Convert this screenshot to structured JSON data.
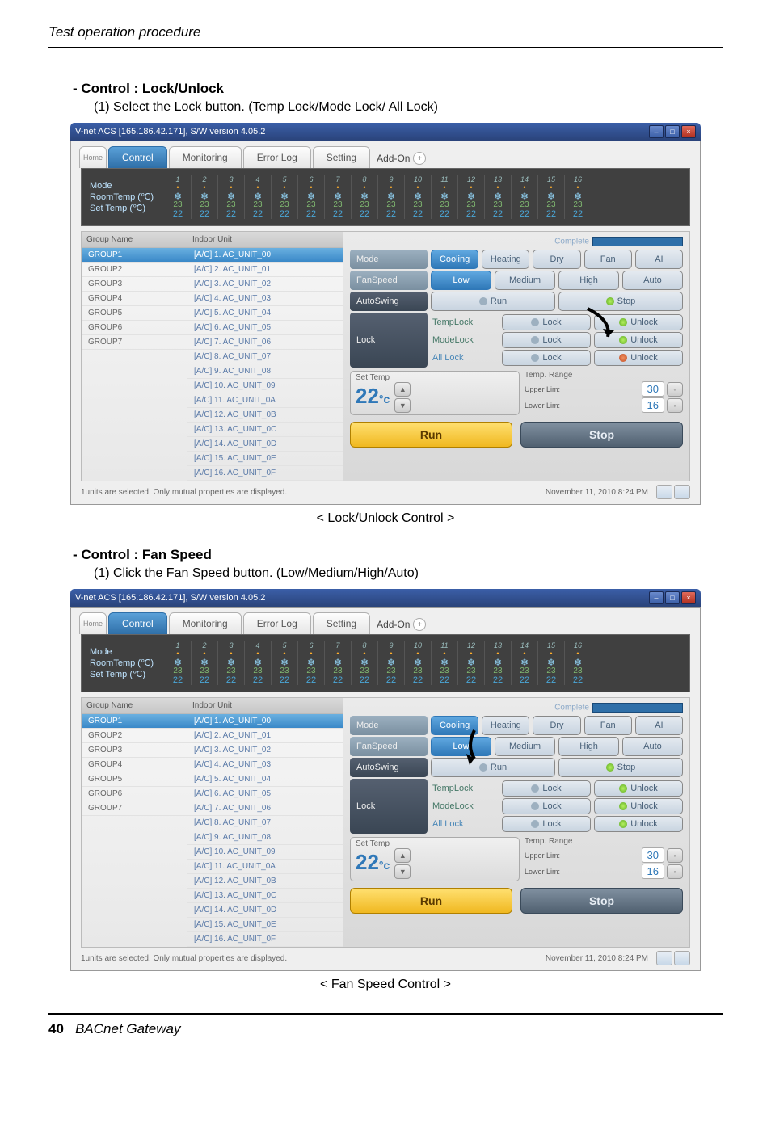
{
  "page_header": "Test operation procedure",
  "sections": [
    {
      "title": "- Control : Lock/Unlock",
      "sub": "(1) Select the Lock button. (Temp Lock/Mode Lock/ All Lock)",
      "caption": "< Lock/Unlock Control >"
    },
    {
      "title": "- Control : Fan Speed",
      "sub": "(1) Click the Fan Speed button. (Low/Medium/High/Auto)",
      "caption": "< Fan Speed Control >"
    }
  ],
  "footer": {
    "page": "40",
    "book": "BACnet Gateway"
  },
  "app": {
    "titlebar": "V-net ACS [165.186.42.171],   S/W version 4.05.2",
    "winbtns": [
      "–",
      "□",
      "×"
    ],
    "tabs": {
      "home": "Home",
      "items": [
        "Control",
        "Monitoring",
        "Error Log",
        "Setting"
      ],
      "active": "Control",
      "addon": "Add-On",
      "plus": "+"
    },
    "darkbar": {
      "labels": [
        "Mode",
        "RoomTemp (℃)",
        "Set Temp   (℃)"
      ],
      "count": 16,
      "indices": [
        "1",
        "2",
        "3",
        "4",
        "5",
        "6",
        "7",
        "8",
        "9",
        "10",
        "11",
        "12",
        "13",
        "14",
        "15",
        "16"
      ],
      "room": "23",
      "set": "22"
    },
    "groups": {
      "header": "Group Name",
      "items": [
        "GROUP1",
        "GROUP2",
        "GROUP3",
        "GROUP4",
        "GROUP5",
        "GROUP6",
        "GROUP7"
      ],
      "selected": "GROUP1"
    },
    "units": {
      "header": "Indoor Unit",
      "items": [
        "[A/C] 1. AC_UNIT_00",
        "[A/C] 2. AC_UNIT_01",
        "[A/C] 3. AC_UNIT_02",
        "[A/C] 4. AC_UNIT_03",
        "[A/C] 5. AC_UNIT_04",
        "[A/C] 6. AC_UNIT_05",
        "[A/C] 7. AC_UNIT_06",
        "[A/C] 8. AC_UNIT_07",
        "[A/C] 9. AC_UNIT_08",
        "[A/C] 10. AC_UNIT_09",
        "[A/C] 11. AC_UNIT_0A",
        "[A/C] 12. AC_UNIT_0B",
        "[A/C] 13. AC_UNIT_0C",
        "[A/C] 14. AC_UNIT_0D",
        "[A/C] 15. AC_UNIT_0E",
        "[A/C] 16. AC_UNIT_0F"
      ],
      "selected": "[A/C] 1. AC_UNIT_00"
    },
    "right": {
      "complete": "Complete",
      "mode": {
        "label": "Mode",
        "opts": [
          "Cooling",
          "Heating",
          "Dry",
          "Fan",
          "AI"
        ],
        "sel": "Cooling"
      },
      "fan": {
        "label": "FanSpeed",
        "opts": [
          "Low",
          "Medium",
          "High",
          "Auto"
        ],
        "sel": "Low"
      },
      "swing": {
        "label": "AutoSwing",
        "run": "Run",
        "stop": "Stop"
      },
      "lock": {
        "label": "Lock",
        "rows": [
          {
            "name": "TempLock",
            "a": "Lock",
            "b": "Unlock"
          },
          {
            "name": "ModeLock",
            "a": "Lock",
            "b": "Unlock"
          },
          {
            "name": "All Lock",
            "a": "Lock",
            "b": "Unlock"
          }
        ]
      },
      "settemp": {
        "label": "Set Temp",
        "range": "Temp. Range",
        "value": "22",
        "unit": "°c",
        "upper": "Upper Lim:",
        "upperv": "30",
        "lower": "Lower Lim:",
        "lowerv": "16"
      },
      "run": "Run",
      "stop": "Stop"
    },
    "status": {
      "left": "1units are selected. Only mutual properties are displayed.",
      "right": "November 11, 2010  8:24 PM"
    }
  }
}
